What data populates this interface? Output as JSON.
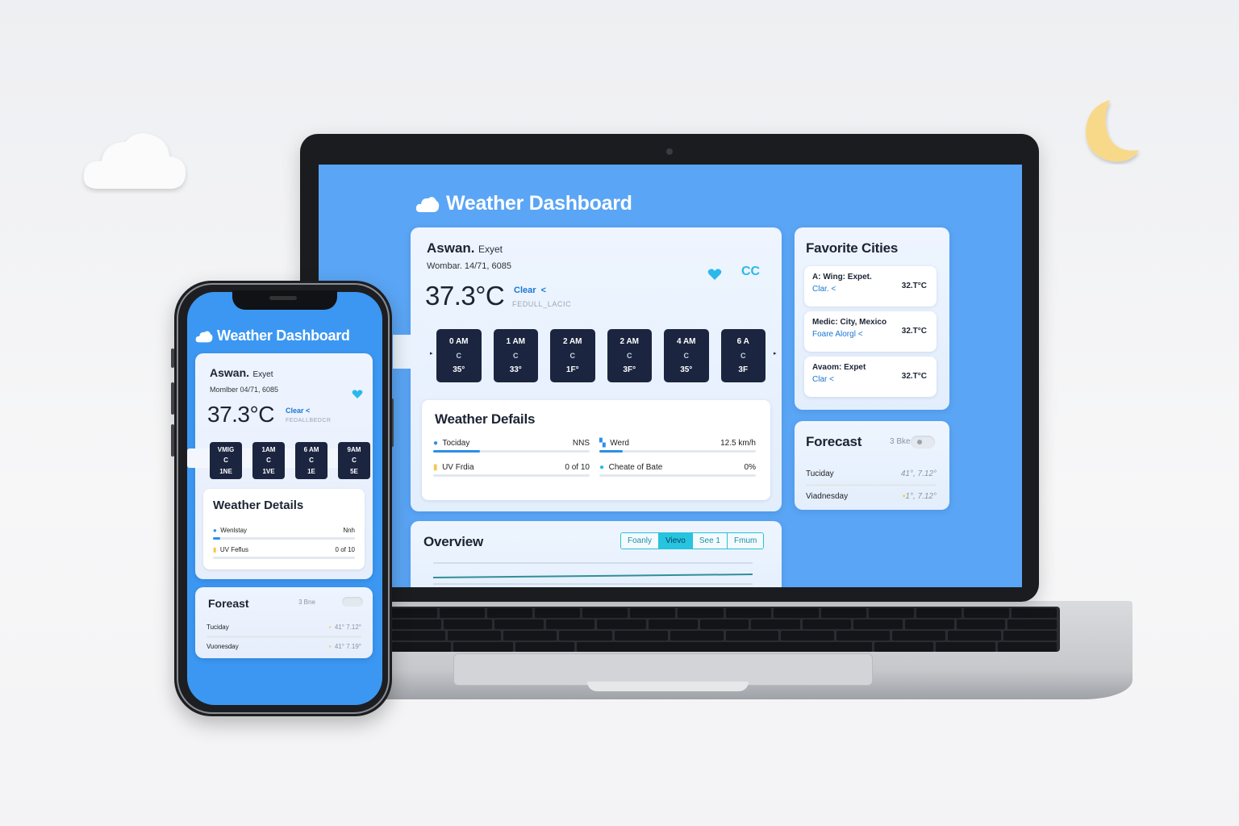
{
  "app": {
    "title": "Weather Dashboard"
  },
  "colors": {
    "accent": "#2b8fea",
    "screen_bg": "#5aa5f5",
    "heart": "#2bb8ea",
    "moon": "#f8d98a"
  },
  "desktop": {
    "current": {
      "city": "Aswan.",
      "country": "Exyet",
      "date": "Wombar. 14/71, 6085",
      "temp": "37.3°C",
      "condition": "Clear",
      "condition_arrow": "<",
      "feels": "FEDULL_LACIC",
      "icons": {
        "favorite": "heart-icon",
        "units": "cc-icon"
      },
      "units_label": "CC"
    },
    "hourly": [
      {
        "time": "0 AM",
        "icon": "C",
        "temp": "35°"
      },
      {
        "time": "1 AM",
        "icon": "C",
        "temp": "33°"
      },
      {
        "time": "2 AM",
        "icon": "C",
        "temp": "1F°"
      },
      {
        "time": "2 AM",
        "icon": "C",
        "temp": "3F°"
      },
      {
        "time": "4 AM",
        "icon": "C",
        "temp": "35°"
      },
      {
        "time": "6 A",
        "icon": "C",
        "temp": "3F"
      }
    ],
    "details": {
      "title": "Weather Defails",
      "rows": [
        {
          "label": "Tociday",
          "value": "NNS",
          "progress": 0.3
        },
        {
          "label": "Werd",
          "value": "12.5 km/h",
          "progress": 0.15
        },
        {
          "label": "UV Frdia",
          "value": "0 of 10",
          "progress": 0
        },
        {
          "label": "Cheate of Bate",
          "value": "0%",
          "progress": 0
        }
      ]
    },
    "favorites": {
      "title": "Favorite Cities",
      "items": [
        {
          "name": "A: Wing:  Expet.",
          "condition": "Clar.  <",
          "temp": "32.T°C"
        },
        {
          "name": "Medic: City, Mexico",
          "condition": "Foare Alorgl  <",
          "temp": "32.T°C"
        },
        {
          "name": "Avaom: Expet",
          "condition": "Clar  <",
          "temp": "32.T°C"
        }
      ]
    },
    "forecast": {
      "title": "Forecast",
      "toggle_label": "3 Bke",
      "rows": [
        {
          "day": "Tuciday",
          "temps": "41°, 7.12°"
        },
        {
          "day": "Viadnesday",
          "temps": "1°, 7.12°"
        }
      ]
    },
    "overview": {
      "title": "Overview",
      "tabs": [
        "Foanly",
        "Vievo",
        "See 1",
        "Fmum"
      ],
      "active_tab": 1
    }
  },
  "mobile": {
    "current": {
      "city": "Aswan.",
      "country": "Exyet",
      "date": "Momlber 04/71, 6085",
      "temp": "37.3°C",
      "condition": "Clear  <",
      "feels": "FEDALLBEDCR"
    },
    "hourly": [
      {
        "time": "VMIG",
        "icon": "C",
        "temp": "1NE"
      },
      {
        "time": "1AM",
        "icon": "C",
        "temp": "1VE"
      },
      {
        "time": "6 AM",
        "icon": "C",
        "temp": "1E"
      },
      {
        "time": "9AM",
        "icon": "C",
        "temp": "5E"
      }
    ],
    "details": {
      "title": "Weather Details",
      "rows": [
        {
          "label": "Wenlstay",
          "value": "Nnh",
          "progress": 0.05
        },
        {
          "label": "UV Feflus",
          "value": "0 of 10",
          "progress": 0
        }
      ]
    },
    "forecast": {
      "title": "Foreast",
      "toggle_label": "3 Bne",
      "rows": [
        {
          "day": "Tuciday",
          "temps": "41°  7.12°"
        },
        {
          "day": "Vuonesday",
          "temps": "41°  7.19°"
        }
      ]
    }
  }
}
